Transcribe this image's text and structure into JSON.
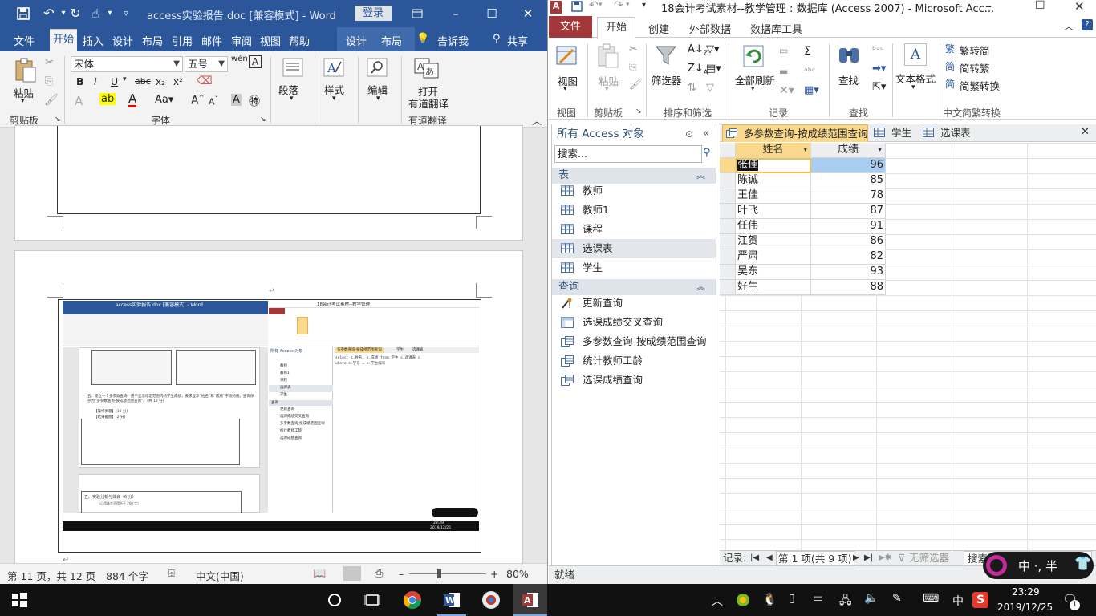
{
  "word": {
    "title_bar": {
      "doc_title": "access实验报告.doc [兼容模式] - Word",
      "login": "登录"
    },
    "tabs": [
      "文件",
      "开始",
      "插入",
      "设计",
      "布局",
      "引用",
      "邮件",
      "审阅",
      "视图",
      "帮助",
      "设计",
      "布局"
    ],
    "tell_me": "告诉我",
    "share": "共享",
    "ribbon": {
      "paste": "粘贴",
      "clipboard_group": "剪贴板",
      "font_name": "宋体",
      "font_size": "五号",
      "font_group": "字体",
      "paragraph": "段落",
      "styles": "样式",
      "editing": "编辑",
      "translate_line1": "打开",
      "translate_line2": "有道翻译",
      "translate_group": "有道翻译"
    },
    "status": {
      "page": "第 11 页，共 12 页",
      "words": "884 个字",
      "lang": "中文(中国)",
      "zoom": "80%"
    },
    "embedded": {
      "title": "access实验报告.doc [兼容模式] - Word",
      "access_title": "18会计考试素材--教学管理",
      "nav_head": "所有 Access 对象",
      "query_tab": "多参数查询-按成绩范围查询",
      "tab2": "学生",
      "tab3": "选课表",
      "nav_items": [
        "教师",
        "教师1",
        "课程",
        "选课表",
        "学生"
      ],
      "query_group": "查询",
      "queries": [
        "更新查询",
        "选课成绩交叉查询",
        "多参数查询-按成绩范围查询",
        "统计教师工龄",
        "选课成绩查询"
      ],
      "sql_line1": "select s.姓名, s.成绩 from 学生 s,选课表 c",
      "sql_line2": "where s.学号 = c.学生编号",
      "task_text": "五、建立一个多参数查询，用于显示指定范围内的学生成绩，要求显示“姓名”和“成绩”字段的值。查询保存为“多参数查询-按成绩范围查询”。（共 12 分）",
      "bullet1": "【操作步骤】(10 分)",
      "bullet2": "【结果截图】(2 分)",
      "section5": "五、实验分析与体会（6 分）",
      "section5_sub": "（心得体会不得低于 200 字）",
      "time": "23:29",
      "date": "2019/12/25"
    }
  },
  "access": {
    "title": "18会计考试素材--教学管理 : 数据库 (Access 2007) - Microsoft Acc...",
    "tabs": {
      "file": "文件",
      "home": "开始",
      "create": "创建",
      "external": "外部数据",
      "tools": "数据库工具"
    },
    "ribbon": {
      "view": "视图",
      "paste": "粘贴",
      "filter": "筛选器",
      "refresh": "全部刷新",
      "find": "查找",
      "text_format": "文本格式",
      "trad": "繁转简",
      "simp": "简转繁",
      "conv": "简繁转换",
      "groups": [
        "视图",
        "剪贴板",
        "排序和筛选",
        "记录",
        "查找",
        "中文简繁转换"
      ]
    },
    "nav": {
      "header": "所有 Access 对象",
      "search_placeholder": "搜索...",
      "tables_group": "表",
      "tables": [
        {
          "label": "教师",
          "selected": false
        },
        {
          "label": "教师1",
          "selected": false
        },
        {
          "label": "课程",
          "selected": false
        },
        {
          "label": "选课表",
          "selected": true
        },
        {
          "label": "学生",
          "selected": false
        }
      ],
      "queries_group": "查询",
      "queries": [
        {
          "label": "更新查询",
          "icon": "update-query-icon"
        },
        {
          "label": "选课成绩交叉查询",
          "icon": "crosstab-query-icon"
        },
        {
          "label": "多参数查询-按成绩范围查询",
          "icon": "select-query-icon"
        },
        {
          "label": "统计教师工龄",
          "icon": "select-query-icon"
        },
        {
          "label": "选课成绩查询",
          "icon": "select-query-icon"
        }
      ]
    },
    "doc_tabs": [
      "多参数查询-按成绩范围查询",
      "学生",
      "选课表"
    ],
    "grid": {
      "columns": [
        "姓名",
        "成绩"
      ],
      "rows": [
        [
          "张佳",
          "96"
        ],
        [
          "陈诚",
          "85"
        ],
        [
          "王佳",
          "78"
        ],
        [
          "叶飞",
          "87"
        ],
        [
          "任伟",
          "91"
        ],
        [
          "江贺",
          "86"
        ],
        [
          "严肃",
          "82"
        ],
        [
          "吴东",
          "93"
        ],
        [
          "好生",
          "88"
        ]
      ]
    },
    "record_nav": {
      "label": "记录:",
      "position": "第 1 项(共 9 项)",
      "filter": "无筛选器",
      "search": "搜索"
    },
    "status": "就绪"
  },
  "ime": {
    "text": "中 ·, 半"
  },
  "taskbar": {
    "ime": "中",
    "time": "23:29",
    "date": "2019/12/25",
    "notifications": "1"
  },
  "colors": {
    "word_blue": "#2b579a",
    "access_red": "#a4373a",
    "active_tab": "#fad98d",
    "selected_cell": "#a9cdf0"
  }
}
